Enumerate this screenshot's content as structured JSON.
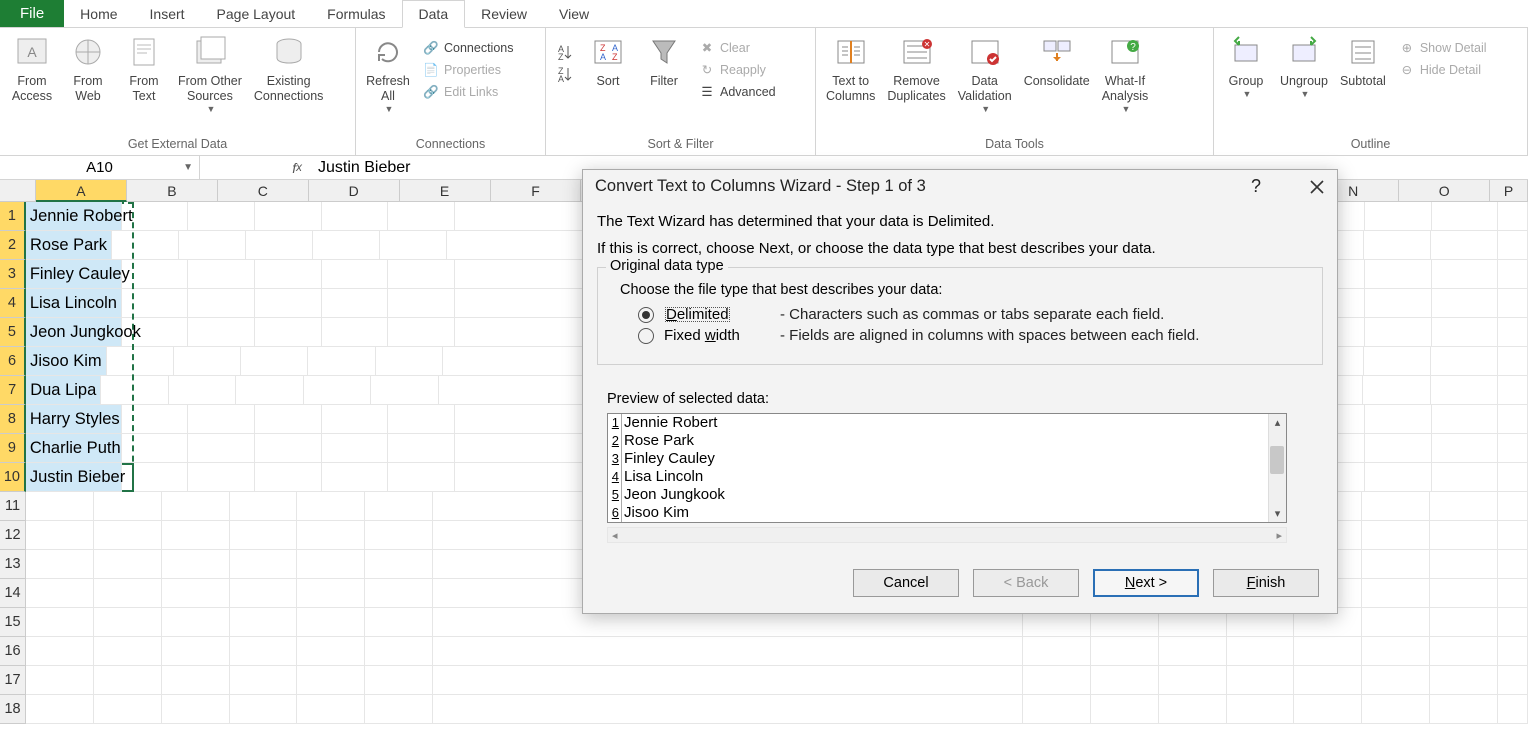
{
  "menu": {
    "file": "File",
    "tabs": [
      "Home",
      "Insert",
      "Page Layout",
      "Formulas",
      "Data",
      "Review",
      "View"
    ],
    "active": "Data"
  },
  "ribbon": {
    "get_external": {
      "label": "Get External Data",
      "items": [
        "From\nAccess",
        "From\nWeb",
        "From\nText",
        "From Other\nSources",
        "Existing\nConnections"
      ]
    },
    "connections": {
      "label": "Connections",
      "refresh": "Refresh\nAll",
      "sub": [
        "Connections",
        "Properties",
        "Edit Links"
      ]
    },
    "sortfilter": {
      "label": "Sort & Filter",
      "sort": "Sort",
      "filter": "Filter",
      "sub": [
        "Clear",
        "Reapply",
        "Advanced"
      ]
    },
    "datatools": {
      "label": "Data Tools",
      "items": [
        "Text to\nColumns",
        "Remove\nDuplicates",
        "Data\nValidation",
        "Consolidate",
        "What-If\nAnalysis"
      ]
    },
    "outline": {
      "label": "Outline",
      "items": [
        "Group",
        "Ungroup",
        "Subtotal"
      ],
      "sub": [
        "Show Detail",
        "Hide Detail"
      ]
    }
  },
  "namebox": "A10",
  "formula": "Justin Bieber",
  "columns": [
    "A",
    "B",
    "C",
    "D",
    "E",
    "F",
    "",
    "",
    "",
    "",
    "",
    "",
    "",
    "N",
    "O",
    "P"
  ],
  "rows_data": [
    "Jennie Robert",
    "Rose Park",
    "Finley Cauley",
    "Lisa Lincoln",
    "Jeon Jungkook",
    "Jisoo Kim",
    "Dua Lipa",
    "Harry Styles",
    "Charlie Puth",
    "Justin Bieber"
  ],
  "total_rows": 18,
  "dialog": {
    "title": "Convert Text to Columns Wizard - Step 1 of 3",
    "line1": "The Text Wizard has determined that your data is Delimited.",
    "line2": "If this is correct, choose Next, or choose the data type that best describes your data.",
    "legend": "Original data type",
    "sub": "Choose the file type that best describes your data:",
    "r1": {
      "label": "Delimited",
      "desc": "- Characters such as commas or tabs separate each field."
    },
    "r2": {
      "label": "Fixed width",
      "desc": "- Fields are aligned in columns with spaces between each field."
    },
    "preview_label": "Preview of selected data:",
    "preview": [
      "Jennie Robert",
      "Rose Park",
      "Finley Cauley",
      "Lisa Lincoln",
      "Jeon Jungkook",
      "Jisoo Kim"
    ],
    "buttons": {
      "cancel": "Cancel",
      "back": "< Back",
      "next": "Next >",
      "finish": "Finish"
    }
  }
}
